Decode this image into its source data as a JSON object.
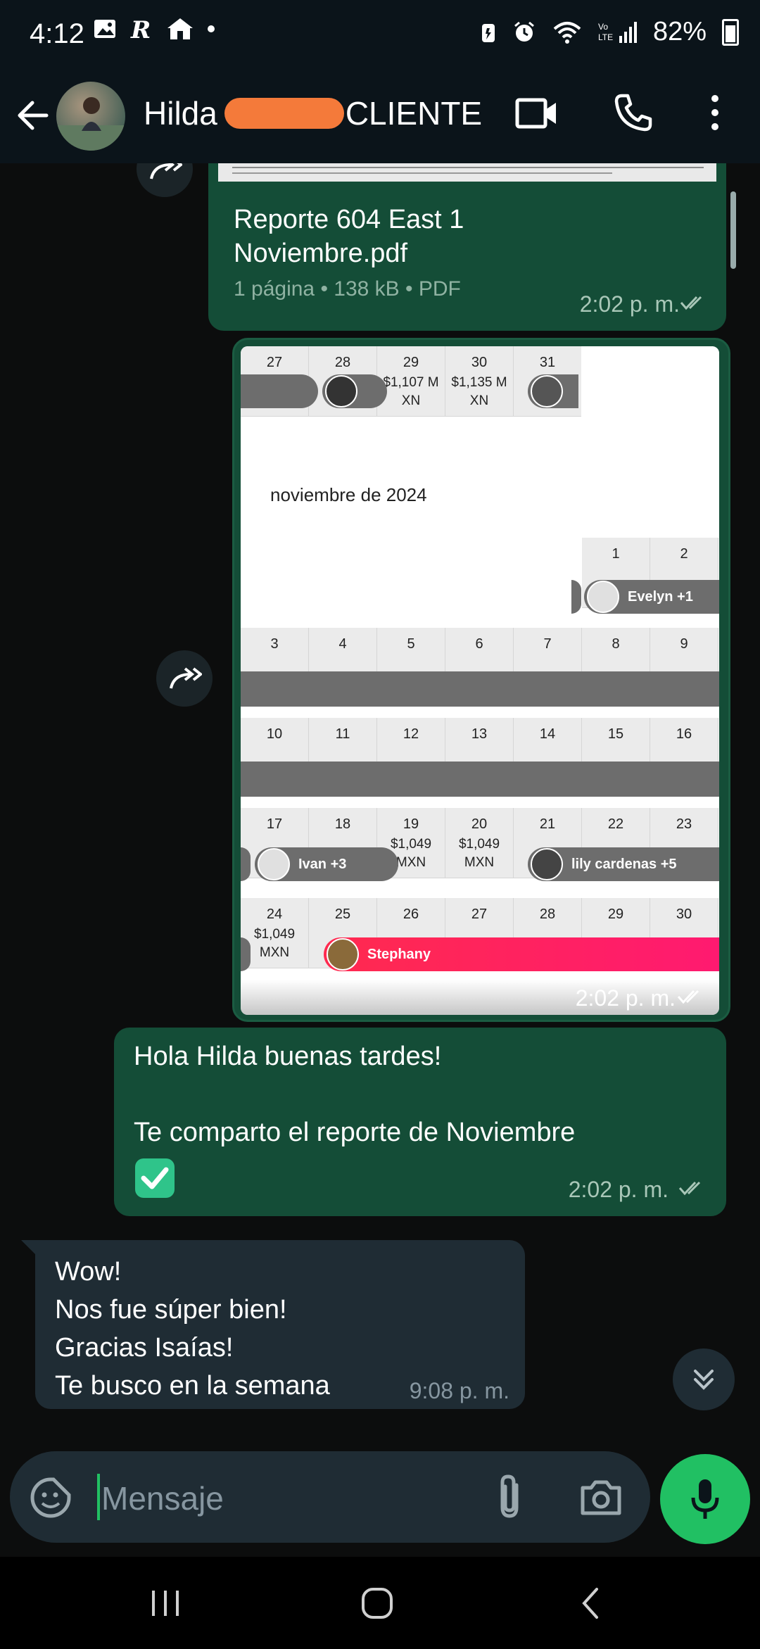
{
  "status_bar": {
    "time": "4:12",
    "battery": "82%"
  },
  "header": {
    "name_first": "Hilda",
    "name_last": "CLIENTE"
  },
  "messages": {
    "pdf": {
      "title_line1": "Reporte 604 East 1",
      "title_line2": "Noviembre.pdf",
      "meta": "1 página • 138 kB • PDF",
      "time": "2:02 p. m."
    },
    "image": {
      "time": "2:02 p. m.",
      "calendar": {
        "month_title": "noviembre de 2024",
        "prev_days": [
          "27",
          "28",
          "29",
          "30",
          "31"
        ],
        "prev_amounts": {
          "29": [
            "$1,107 M",
            "XN"
          ],
          "30": [
            "$1,135 M",
            "XN"
          ]
        },
        "week0": [
          "1",
          "2"
        ],
        "week1": [
          "3",
          "4",
          "5",
          "6",
          "7",
          "8",
          "9"
        ],
        "week2": [
          "10",
          "11",
          "12",
          "13",
          "14",
          "15",
          "16"
        ],
        "week3": [
          "17",
          "18",
          "19",
          "20",
          "21",
          "22",
          "23"
        ],
        "week3_amounts": {
          "19": [
            "$1,049",
            "MXN"
          ],
          "20": [
            "$1,049",
            "MXN"
          ]
        },
        "week4": [
          "24",
          "25",
          "26",
          "27",
          "28",
          "29",
          "30"
        ],
        "week4_amounts": {
          "24": [
            "$1,049",
            "MXN"
          ]
        },
        "events": {
          "evelyn": "Evelyn +1",
          "ivan": "Ivan +3",
          "lily": "lily cardenas +5",
          "stephany": "Stephany"
        }
      }
    },
    "text_out": {
      "line1": "Hola Hilda buenas tardes!",
      "line2": "Te comparto el reporte de Noviembre",
      "time": "2:02 p. m."
    },
    "text_in": {
      "line1": "Wow!",
      "line2": "Nos fue súper bien!",
      "line3": "Gracias Isaías!",
      "line4": "Te busco en la semana",
      "time": "9:08 p. m."
    }
  },
  "input": {
    "placeholder": "Mensaje"
  },
  "colors": {
    "accent": "#21c063",
    "bubble_out": "#144d37",
    "bubble_in": "#1f2c34",
    "stephany_event": "#ff1f5a"
  }
}
